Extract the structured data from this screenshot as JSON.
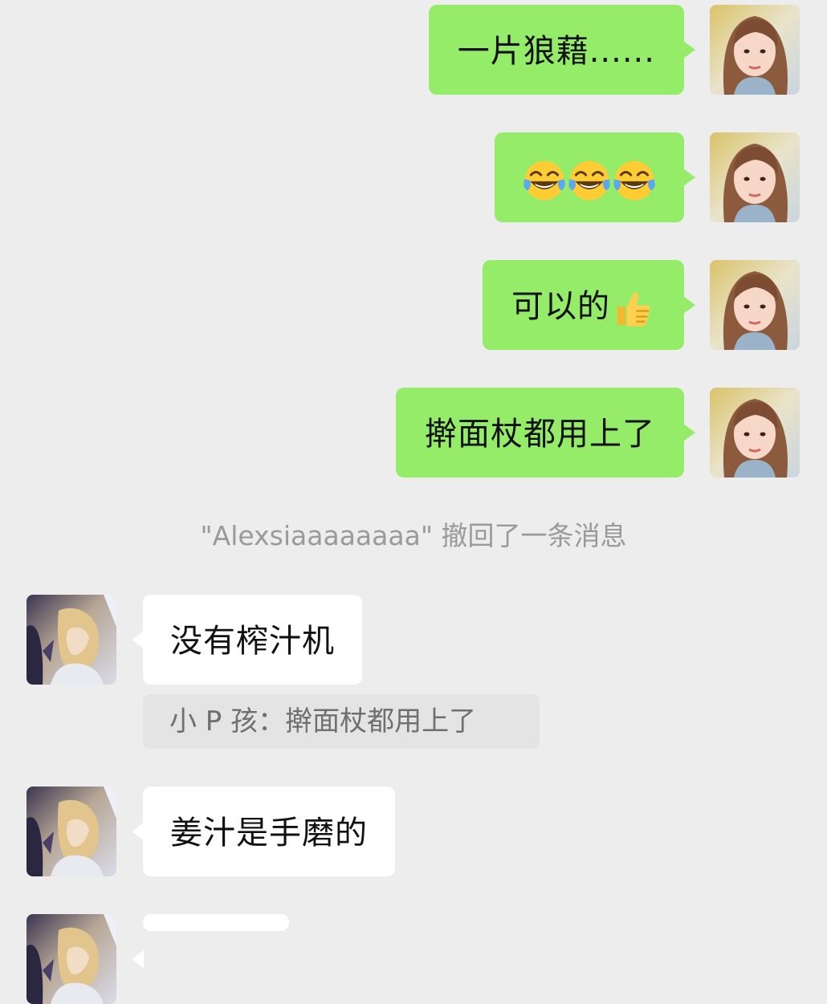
{
  "messages": {
    "out1": "一片狼藉......",
    "out2": "",
    "out3": "可以的",
    "out4": "擀面杖都用上了",
    "in1": "没有榨汁机",
    "in2": "姜汁是手磨的"
  },
  "emoji": {
    "out2": [
      "face-with-tears-of-joy",
      "face-with-tears-of-joy",
      "face-with-tears-of-joy"
    ],
    "out3": "thumbs-up"
  },
  "system_notice": "\"Alexsiaaaaaaaa\" 撤回了一条消息",
  "quote": {
    "text": "小 P 孩：擀面杖都用上了"
  },
  "colors": {
    "background": "#ededed",
    "outgoing_bubble": "#95ec69",
    "incoming_bubble": "#ffffff",
    "notice_text": "#9a9a9a",
    "quote_bg": "#e4e4e4"
  }
}
